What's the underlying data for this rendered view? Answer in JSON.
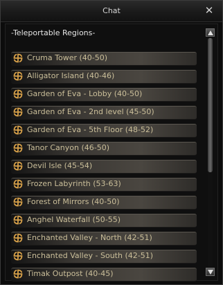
{
  "window": {
    "title": "Chat",
    "close_label": "✕"
  },
  "heading": "-Teleportable Regions-",
  "teleport_icon": "teleport-swirl-icon",
  "colors": {
    "label_text": "#cbbf9a",
    "icon_gold": "#d9a24a"
  },
  "regions": [
    {
      "label": "Cruma Tower (40-50)"
    },
    {
      "label": "Alligator Island (40-46)"
    },
    {
      "label": "Garden of Eva - Lobby (40-50)"
    },
    {
      "label": "Garden of Eva - 2nd level (45-50)"
    },
    {
      "label": "Garden of Eva - 5th Floor (48-52)"
    },
    {
      "label": "Tanor Canyon (46-50)"
    },
    {
      "label": "Devil Isle (45-54)"
    },
    {
      "label": "Frozen Labyrinth (53-63)"
    },
    {
      "label": "Forest of Mirrors (40-50)"
    },
    {
      "label": "Anghel Waterfall (50-55)"
    },
    {
      "label": "Enchanted Valley - North (42-51)"
    },
    {
      "label": "Enchanted Valley - South (42-51)"
    },
    {
      "label": "Timak Outpost (40-45)"
    }
  ]
}
